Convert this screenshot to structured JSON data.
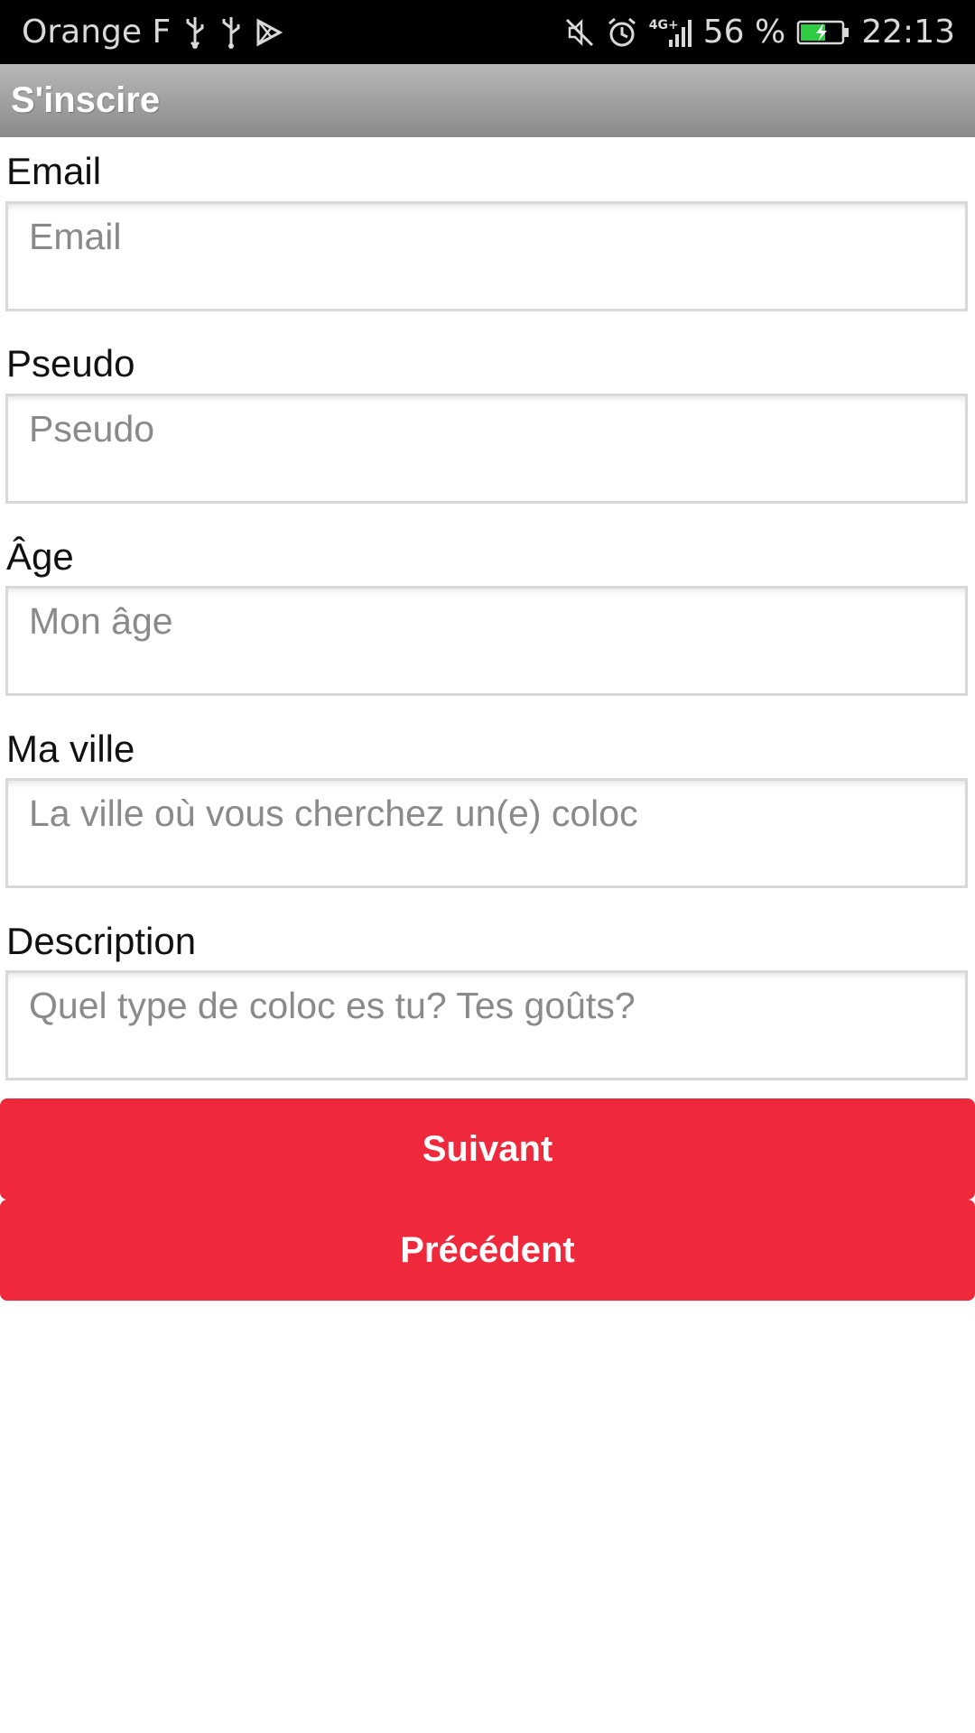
{
  "status_bar": {
    "carrier": "Orange F",
    "battery_percent": "56 %",
    "time": "22:13",
    "icons": [
      "usb-icon",
      "usb-icon",
      "play-store-icon",
      "mute-icon",
      "alarm-icon",
      "signal-4g-icon",
      "battery-charging-icon"
    ],
    "network_label": "4G+"
  },
  "action_bar": {
    "title": "S'inscire"
  },
  "form": {
    "fields": [
      {
        "label": "Email",
        "placeholder": "Email"
      },
      {
        "label": "Pseudo",
        "placeholder": "Pseudo"
      },
      {
        "label": "Âge",
        "placeholder": "Mon âge"
      },
      {
        "label": "Ma ville",
        "placeholder": "La ville où vous cherchez un(e) coloc"
      },
      {
        "label": "Description",
        "placeholder": "Quel type de coloc es tu? Tes goûts?"
      }
    ]
  },
  "buttons": {
    "next_label": "Suivant",
    "previous_label": "Précédent"
  },
  "colors": {
    "accent": "#ef283c",
    "status_bar": "#000000",
    "action_bar": "#9a9a9a"
  }
}
